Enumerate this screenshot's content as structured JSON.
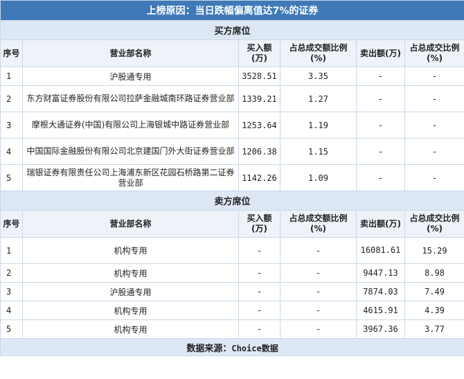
{
  "title": "上榜原因：当日跌幅偏离值达7%的证券",
  "buy_section": "买方席位",
  "sell_section": "卖方席位",
  "headers": {
    "seq": "序号",
    "name": "营业部名称",
    "buy_amount": "买入额(万)",
    "buy_ratio": "占总成交额比例(%)",
    "sell_amount": "卖出额(万)",
    "sell_ratio": "占总成交比例(%)"
  },
  "buy_rows": [
    {
      "seq": "1",
      "name": "沪股通专用",
      "buy": "3528.51",
      "buy_ratio": "3.35",
      "sell": "-",
      "sell_ratio": "-"
    },
    {
      "seq": "2",
      "name": "东方财富证券股份有限公司拉萨金融城南环路证券营业部",
      "buy": "1339.21",
      "buy_ratio": "1.27",
      "sell": "-",
      "sell_ratio": "-"
    },
    {
      "seq": "3",
      "name": "摩根大通证券(中国)有限公司上海银城中路证券营业部",
      "buy": "1253.64",
      "buy_ratio": "1.19",
      "sell": "-",
      "sell_ratio": "-"
    },
    {
      "seq": "4",
      "name": "中国国际金融股份有限公司北京建国门外大街证券营业部",
      "buy": "1206.38",
      "buy_ratio": "1.15",
      "sell": "-",
      "sell_ratio": "-"
    },
    {
      "seq": "5",
      "name": "瑞银证券有限责任公司上海浦东新区花园石桥路第二证券营业部",
      "buy": "1142.26",
      "buy_ratio": "1.09",
      "sell": "-",
      "sell_ratio": "-"
    }
  ],
  "sell_rows": [
    {
      "seq": "1",
      "name": "机构专用",
      "buy": "-",
      "buy_ratio": "-",
      "sell": "16081.61",
      "sell_ratio": "15.29"
    },
    {
      "seq": "2",
      "name": "机构专用",
      "buy": "-",
      "buy_ratio": "-",
      "sell": "9447.13",
      "sell_ratio": "8.98"
    },
    {
      "seq": "3",
      "name": "沪股通专用",
      "buy": "-",
      "buy_ratio": "-",
      "sell": "7874.03",
      "sell_ratio": "7.49"
    },
    {
      "seq": "4",
      "name": "机构专用",
      "buy": "-",
      "buy_ratio": "-",
      "sell": "4615.91",
      "sell_ratio": "4.39"
    },
    {
      "seq": "5",
      "name": "机构专用",
      "buy": "-",
      "buy_ratio": "-",
      "sell": "3967.36",
      "sell_ratio": "3.77"
    }
  ],
  "footer_label": "数据来源：",
  "footer_source": "Choice数据"
}
